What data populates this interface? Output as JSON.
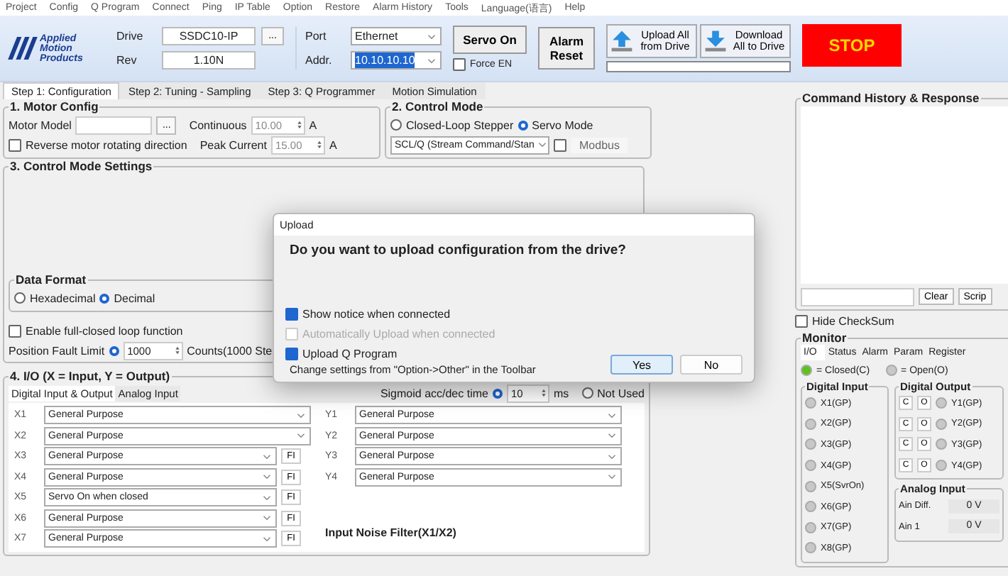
{
  "menu": [
    "Project",
    "Config",
    "Q Program",
    "Connect",
    "Ping",
    "IP Table",
    "Option",
    "Restore",
    "Alarm History",
    "Tools",
    "Language(语言)",
    "Help"
  ],
  "toolbar": {
    "logo": [
      "Applied",
      "Motion",
      "Products"
    ],
    "drive_label": "Drive",
    "drive": "SSDC10-IP",
    "browse": "...",
    "rev_label": "Rev",
    "rev": "1.10N",
    "port_label": "Port",
    "port": "Ethernet",
    "addr_label": "Addr.",
    "addr": "10.10.10.10",
    "servo_on": "Servo On",
    "force_en": {
      "label": "Force EN",
      "checked": false
    },
    "alarm_reset": "Alarm Reset",
    "upload": "Upload All from Drive",
    "download": "Download All to Drive",
    "progress": {
      "level": 0
    },
    "stop": "STOP"
  },
  "tabs": [
    {
      "label": "Step 1: Configuration",
      "selected": true
    },
    {
      "label": "Step 2: Tuning - Sampling",
      "selected": false
    },
    {
      "label": "Step 3: Q Programmer",
      "selected": false
    },
    {
      "label": "Motion Simulation",
      "selected": false
    }
  ],
  "motor_config": {
    "title": "1. Motor Config",
    "model_label": "Motor Model",
    "browse": "...",
    "continuous_label": "Continuous",
    "continuous": "10.00",
    "continuous_unit": "A",
    "peak_label": "Peak Current",
    "peak": "15.00",
    "peak_unit": "A",
    "reverse": {
      "label": "Reverse motor rotating direction",
      "checked": false
    }
  },
  "control_mode": {
    "title": "2. Control Mode",
    "modes": [
      {
        "label": "Closed-Loop Stepper",
        "selected": false
      },
      {
        "label": "Servo Mode",
        "selected": true
      }
    ],
    "protocol": "SCL/Q (Stream Command/Stan",
    "modbus": {
      "label": "Modbus",
      "checked": false
    }
  },
  "mode_settings": {
    "title": "3. Control Mode Settings",
    "data_format": {
      "title": "Data Format",
      "options": [
        {
          "label": "Hexadecimal",
          "selected": false
        },
        {
          "label": "Decimal",
          "selected": true
        }
      ]
    },
    "full_closed": {
      "label": "Enable full-closed loop function",
      "checked": false
    },
    "fault_limit": {
      "label": "Position Fault Limit",
      "selected": true,
      "value": "1000",
      "unit": "Counts(1000 Ste"
    }
  },
  "io": {
    "title": "4. I/O (X = Input, Y = Output)",
    "tabs": [
      {
        "label": "Digital Input & Output",
        "selected": true
      },
      {
        "label": "Analog Input",
        "selected": false
      }
    ],
    "sigmoid": {
      "label": "Sigmoid acc/dec time",
      "selected": true,
      "value": "10",
      "unit": "ms",
      "not_used": {
        "label": "Not Used",
        "selected": false
      }
    },
    "inputs": [
      {
        "label": "X1",
        "value": "General Purpose"
      },
      {
        "label": "X2",
        "value": "General Purpose"
      },
      {
        "label": "X3",
        "value": "General Purpose",
        "button": "FI"
      },
      {
        "label": "X4",
        "value": "General Purpose",
        "button": "FI"
      },
      {
        "label": "X5",
        "value": "Servo On when closed",
        "button": "FI"
      },
      {
        "label": "X6",
        "value": "General Purpose",
        "button": "FI"
      },
      {
        "label": "X7",
        "value": "General Purpose",
        "button": "FI"
      }
    ],
    "outputs": [
      {
        "label": "Y1",
        "value": "General Purpose"
      },
      {
        "label": "Y2",
        "value": "General Purpose"
      },
      {
        "label": "Y3",
        "value": "General Purpose"
      },
      {
        "label": "Y4",
        "value": "General Purpose"
      }
    ],
    "noise_filter": "Input Noise Filter(X1/X2)"
  },
  "command_history": {
    "title": "Command History & Response",
    "clear": "Clear",
    "script": "Scrip",
    "hide_checksum": {
      "label": "Hide CheckSum",
      "checked": false
    }
  },
  "monitor": {
    "title": "Monitor",
    "tabs": [
      {
        "label": "I/O",
        "selected": true
      },
      {
        "label": "Status",
        "selected": false
      },
      {
        "label": "Alarm",
        "selected": false
      },
      {
        "label": "Param",
        "selected": false
      },
      {
        "label": "Register",
        "selected": false
      }
    ],
    "legend": [
      {
        "color": "#5cc21c",
        "label": "= Closed(C)"
      },
      {
        "color": "#c8c8c8",
        "label": "= Open(O)"
      }
    ],
    "digital_input": {
      "title": "Digital Input",
      "items": [
        {
          "label": "X1(GP)",
          "on": false
        },
        {
          "label": "X2(GP)",
          "on": false
        },
        {
          "label": "X3(GP)",
          "on": false
        },
        {
          "label": "X4(GP)",
          "on": false
        },
        {
          "label": "X5(SvrOn)",
          "on": false
        },
        {
          "label": "X6(GP)",
          "on": false
        },
        {
          "label": "X7(GP)",
          "on": false
        },
        {
          "label": "X8(GP)",
          "on": false
        }
      ]
    },
    "digital_output": {
      "title": "Digital Output",
      "items": [
        {
          "close": "C",
          "open": "O",
          "label": "Y1(GP)",
          "on": false
        },
        {
          "close": "C",
          "open": "O",
          "label": "Y2(GP)",
          "on": false
        },
        {
          "close": "C",
          "open": "O",
          "label": "Y3(GP)",
          "on": false
        },
        {
          "close": "C",
          "open": "O",
          "label": "Y4(GP)",
          "on": false
        }
      ]
    },
    "analog_input": {
      "title": "Analog Input",
      "items": [
        {
          "label": "Ain Diff.",
          "value": "0 V"
        },
        {
          "label": "Ain 1",
          "value": "0 V"
        }
      ]
    }
  },
  "dialog": {
    "title": "Upload",
    "question": "Do you want to upload configuration from the drive?",
    "options": [
      {
        "label": "Show notice when connected",
        "checked": true,
        "disabled": false
      },
      {
        "label": "Automatically Upload when connected",
        "checked": false,
        "disabled": true
      },
      {
        "label": "Upload Q Program",
        "checked": true,
        "disabled": false
      }
    ],
    "hint": "Change settings from \"Option->Other\" in the Toolbar",
    "buttons": [
      {
        "label": "Yes",
        "selected": true
      },
      {
        "label": "No",
        "selected": false
      }
    ]
  }
}
